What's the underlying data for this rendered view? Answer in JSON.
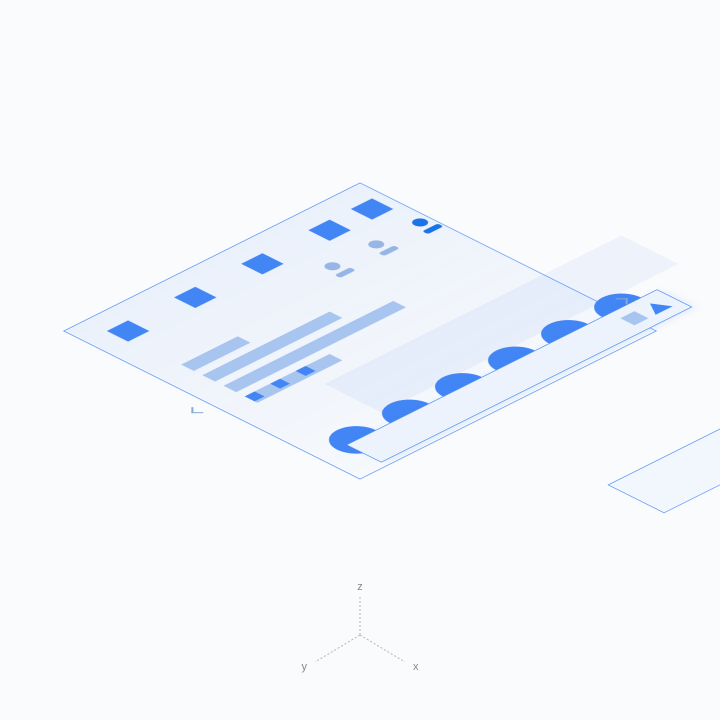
{
  "axis": {
    "x": "x",
    "y": "y",
    "z": "z"
  },
  "colors": {
    "primary": "#4285f4",
    "light": "#a8c5f0",
    "panel": "#edf3fd",
    "outline": "#4285f4"
  },
  "nav": {
    "items": [
      "square",
      "triangle"
    ]
  },
  "avatars": {
    "count": 3,
    "active_index": 2
  },
  "tiles": {
    "count": 5
  },
  "circles": {
    "count": 6
  },
  "overlay": {
    "present": true
  }
}
